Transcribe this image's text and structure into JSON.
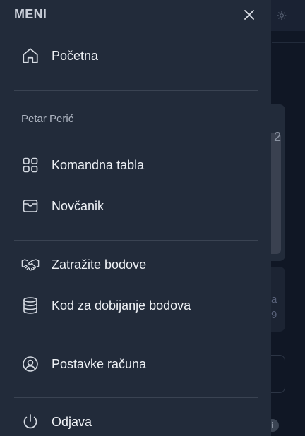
{
  "drawer": {
    "title": "MENI",
    "home": "Početna",
    "user_name": "Petar Perić",
    "dashboard": "Komandna tabla",
    "wallet": "Novčanik",
    "claim_points": "Zatražite bodove",
    "points_code": "Kod za dobijanje bodova",
    "account_settings": "Postavke računa",
    "logout": "Odjava"
  },
  "background": {
    "card_digit": "2",
    "card_text_1": "a",
    "card_text_2": "9",
    "info_glyph": "i"
  },
  "colors": {
    "drawer_bg": "#222b3a",
    "page_bg": "#111827",
    "text": "#eef1f5",
    "muted_text": "#aeb5c1",
    "divider": "#3a4352"
  }
}
